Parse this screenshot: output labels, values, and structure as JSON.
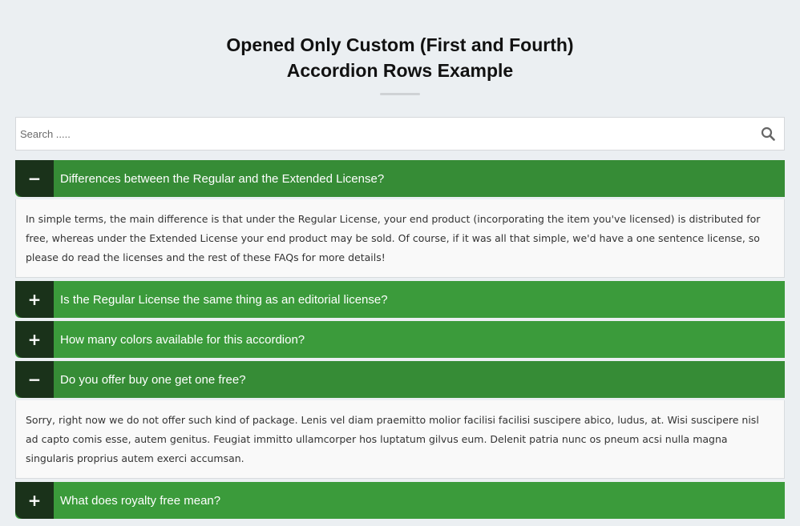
{
  "header": {
    "title_line1": "Opened Only Custom (First and Fourth)",
    "title_line2": "Accordion Rows Example"
  },
  "search": {
    "placeholder": "Search .....",
    "value": "",
    "icon": "search-icon"
  },
  "colors": {
    "accent": "#3b9b3b",
    "accent_open": "#368c36",
    "toggle_bg": "#1a321a",
    "page_bg": "#ebeff2"
  },
  "accordion": {
    "items": [
      {
        "question": "Differences between the Regular and the Extended License?",
        "open": true,
        "toggle_symbol": "−",
        "answer": "In simple terms, the main difference is that under the Regular License, your end product (incorporating the item you've licensed) is distributed for free, whereas under the Extended License your end product may be sold. Of course, if it was all that simple, we'd have a one sentence license, so please do read the licenses and the rest of these FAQs for more details!"
      },
      {
        "question": "Is the Regular License the same thing as an editorial license?",
        "open": false,
        "toggle_symbol": "+"
      },
      {
        "question": "How many colors available for this accordion?",
        "open": false,
        "toggle_symbol": "+"
      },
      {
        "question": "Do you offer buy one get one free?",
        "open": true,
        "toggle_symbol": "−",
        "answer": "Sorry, right now we do not offer such kind of package. Lenis vel diam praemitto molior facilisi facilisi suscipere abico, ludus, at. Wisi suscipere nisl ad capto comis esse, autem genitus. Feugiat immitto ullamcorper hos luptatum gilvus eum. Delenit patria nunc os pneum acsi nulla magna singularis proprius autem exerci accumsan."
      },
      {
        "question": "What does royalty free mean?",
        "open": false,
        "toggle_symbol": "+"
      }
    ]
  }
}
